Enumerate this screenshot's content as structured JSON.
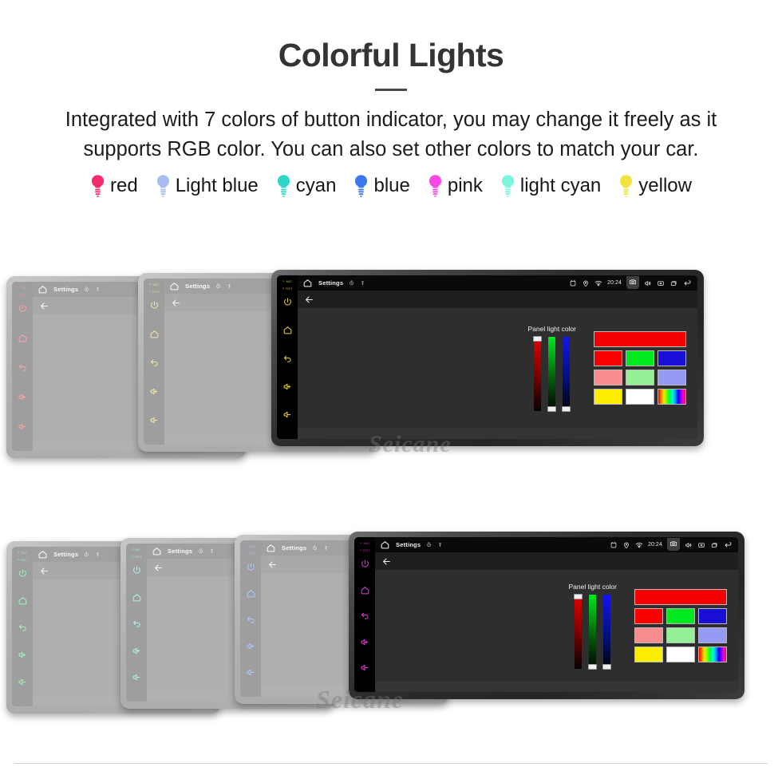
{
  "header": {
    "title": "Colorful Lights",
    "subtitle": "Integrated with 7 colors of button indicator, you may change it freely as it supports RGB color. You can also set other colors to match your car."
  },
  "legend": {
    "items": [
      {
        "label": "red",
        "color": "#F52D6A",
        "icon": "bulb-icon"
      },
      {
        "label": "Light blue",
        "color": "#A8BCF2",
        "icon": "bulb-icon"
      },
      {
        "label": "cyan",
        "color": "#2ED6C8",
        "icon": "bulb-icon"
      },
      {
        "label": "blue",
        "color": "#3C79EE",
        "icon": "bulb-icon"
      },
      {
        "label": "pink",
        "color": "#FC48E2",
        "icon": "bulb-icon"
      },
      {
        "label": "light cyan",
        "color": "#7DF5DD",
        "icon": "bulb-icon"
      },
      {
        "label": "yellow",
        "color": "#F2E23F",
        "icon": "bulb-icon"
      }
    ]
  },
  "device_screen": {
    "status_bar": {
      "home_icon": "home-icon",
      "title": "Settings",
      "timer_icon": "timer-icon",
      "antenna_icon": "antenna-icon",
      "alarm_icon": "alarm-icon",
      "location_icon": "location-icon",
      "signal_icon": "signal-icon",
      "clock": "20:24",
      "camera_icon": "camera-icon",
      "volume_icon": "volume-icon",
      "close_icon": "close-box-icon",
      "recents_icon": "recents-icon",
      "back_icon": "back-arrow-icon"
    },
    "action_bar": {
      "back_icon": "back-arrow-icon"
    },
    "panel": {
      "label": "Panel light color",
      "sliders": [
        {
          "name": "red",
          "value": 100,
          "color": "#E60000",
          "thumb": "top"
        },
        {
          "name": "green",
          "value": 0,
          "color": "#00E81C",
          "thumb": "bottom"
        },
        {
          "name": "blue",
          "value": 0,
          "color": "#1414F0",
          "thumb": "bottom"
        }
      ],
      "preview_color": "#F40000",
      "swatch_rows": [
        [
          "#FB0000",
          "#00E81E",
          "#1A0FD6"
        ],
        [
          "#F98C8C",
          "#96F196",
          "#959BF4"
        ],
        [
          "#FBEE00",
          "#FFFFFF",
          "rainbow"
        ]
      ]
    },
    "side_buttons": {
      "tags": [
        "MIC",
        "RST"
      ],
      "icons": [
        "power-icon",
        "home-icon",
        "back-icon",
        "volume-up-icon",
        "volume-down-icon"
      ]
    }
  },
  "rows": {
    "top": {
      "devices": [
        {
          "accent": "#E01B24",
          "variant": "partial",
          "faded": true
        },
        {
          "accent": "#F0C018",
          "variant": "partial",
          "faded": true
        },
        {
          "accent": "#E8D32A",
          "variant": "full",
          "faded": false
        }
      ]
    },
    "bottom": {
      "devices": [
        {
          "accent": "#15D94A",
          "variant": "partial",
          "faded": true
        },
        {
          "accent": "#21E0D2",
          "variant": "partial",
          "faded": true
        },
        {
          "accent": "#2C6FF5",
          "variant": "partial",
          "faded": true
        },
        {
          "accent": "#E33CE0",
          "variant": "full",
          "faded": false
        }
      ]
    }
  },
  "watermark": {
    "text": "Seicane"
  }
}
